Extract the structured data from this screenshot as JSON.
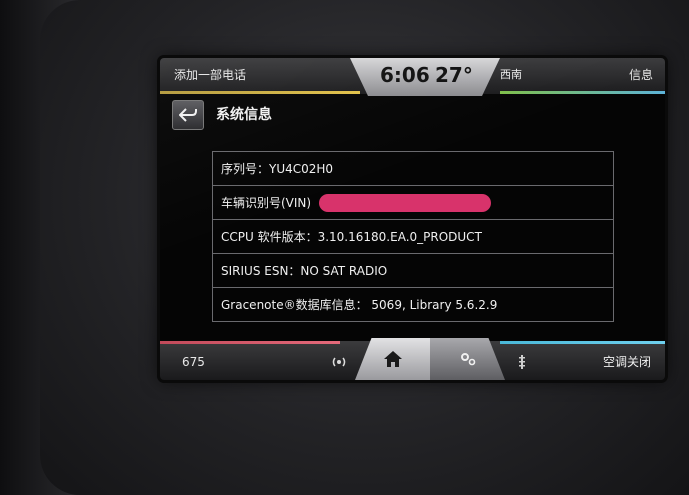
{
  "status_bar": {
    "phone_label": "添加一部电话",
    "time": "6:06",
    "temperature": "27°",
    "compass": "西南",
    "info_label": "信息"
  },
  "page": {
    "title": "系统信息"
  },
  "info_rows": [
    {
      "text": "序列号：YU4C02H0"
    },
    {
      "label": "车辆识别号(VIN)",
      "value_redacted": true
    },
    {
      "text": "CCPU 软件版本：3.10.16180.EA.0_PRODUCT"
    },
    {
      "text": "SIRIUS ESN：NO SAT RADIO"
    },
    {
      "text": "Gracenote®数据库信息： 5069, Library 5.6.2.9"
    }
  ],
  "bottom_bar": {
    "frequency": "675",
    "ac_label": "空调关闭",
    "icons": [
      "radio-icon",
      "home-icon",
      "settings-gear-icon",
      "fan-icon"
    ]
  },
  "colors": {
    "accent_top_left": "#e2c24a",
    "accent_top_right": "#5db3d8",
    "accent_bottom_left": "#e56a7b",
    "accent_bottom_right": "#6fd0ee",
    "vin_redaction": "#d8336b"
  }
}
